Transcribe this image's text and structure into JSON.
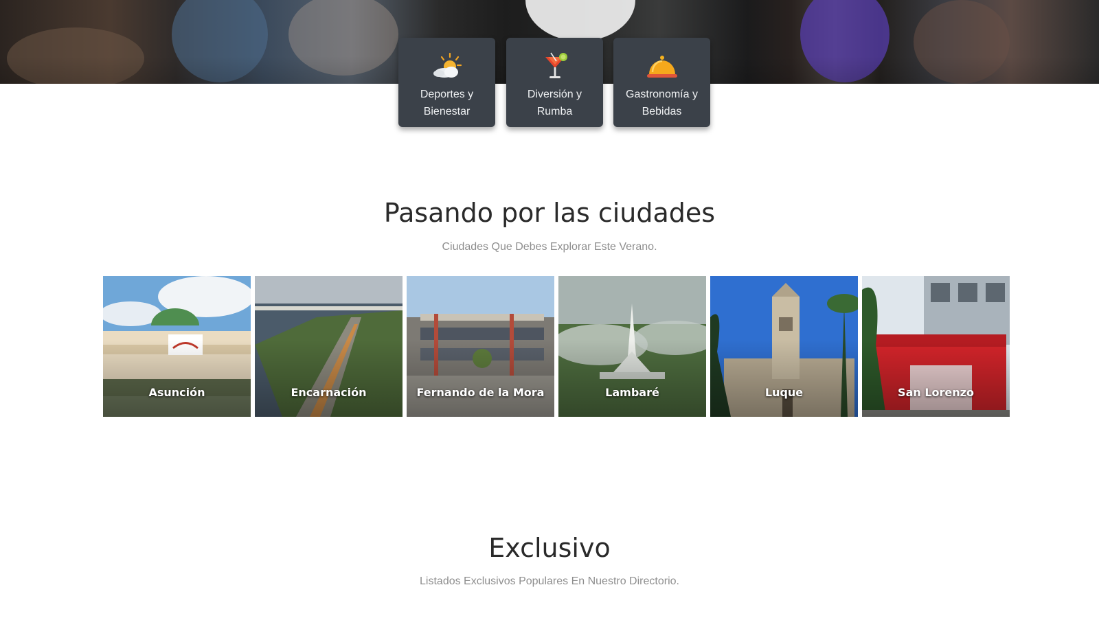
{
  "categories": [
    {
      "label": "Deportes y Bienestar",
      "icon": "sun-cloud-icon"
    },
    {
      "label": "Diversión y Rumba",
      "icon": "cocktail-icon"
    },
    {
      "label": "Gastronomía y Bebidas",
      "icon": "food-cloche-icon"
    }
  ],
  "cities_section": {
    "title": "Pasando por las ciudades",
    "subtitle": "Ciudades Que Debes Explorar Este Verano."
  },
  "cities": [
    {
      "name": "Asunción"
    },
    {
      "name": "Encarnación"
    },
    {
      "name": "Fernando de la Mora"
    },
    {
      "name": "Lambaré"
    },
    {
      "name": "Luque"
    },
    {
      "name": "San Lorenzo"
    }
  ],
  "exclusive_section": {
    "title": "Exclusivo",
    "subtitle": "Listados Exclusivos Populares En Nuestro Directorio."
  },
  "colors": {
    "card_bg": "#3b4149",
    "title_text": "#2a2a2a",
    "subtitle_text": "#8e8e8e"
  }
}
